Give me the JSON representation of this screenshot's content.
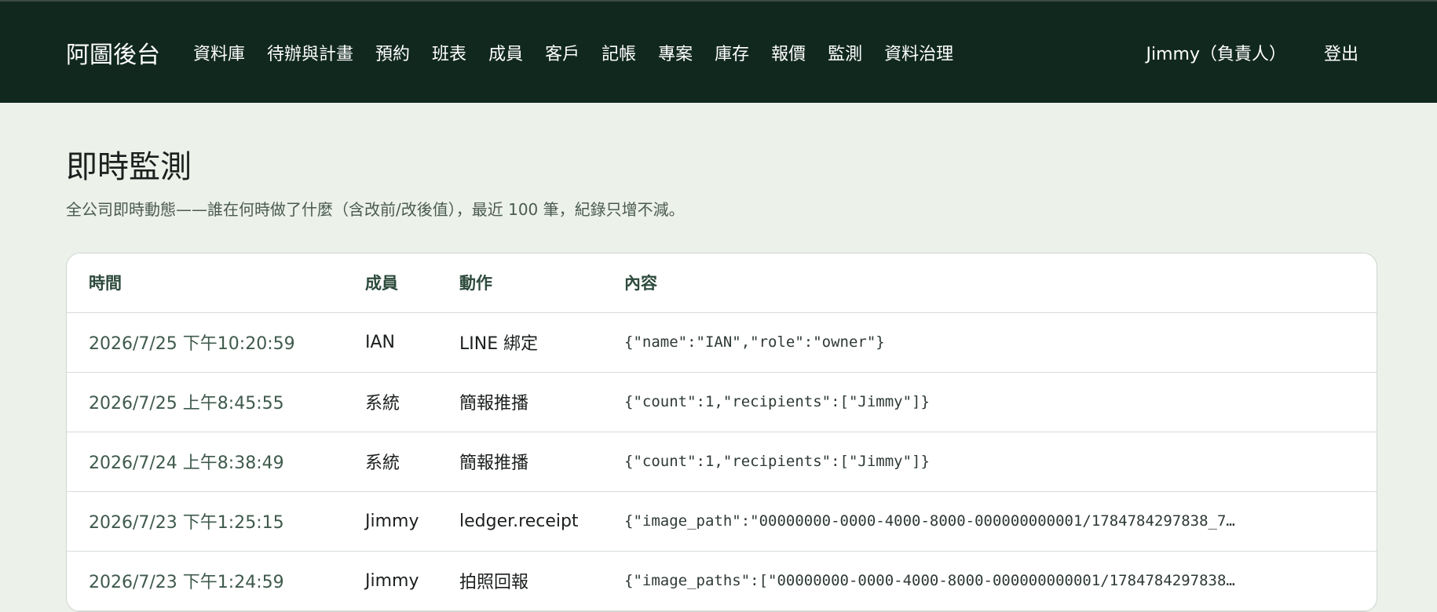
{
  "header": {
    "brand": "阿圖後台",
    "nav": [
      "資料庫",
      "待辦與計畫",
      "預約",
      "班表",
      "成員",
      "客戶",
      "記帳",
      "專案",
      "庫存",
      "報價",
      "監測",
      "資料治理"
    ],
    "user": "Jimmy（負責人）",
    "logout": "登出"
  },
  "page": {
    "title": "即時監測",
    "subtitle": "全公司即時動態——誰在何時做了什麼（含改前/改後值），最近 100 筆，紀錄只增不減。"
  },
  "table": {
    "columns": [
      "時間",
      "成員",
      "動作",
      "內容"
    ],
    "rows": [
      {
        "time": "2026/7/25 下午10:20:59",
        "member": "IAN",
        "action": "LINE 綁定",
        "content": "{\"name\":\"IAN\",\"role\":\"owner\"}"
      },
      {
        "time": "2026/7/25 上午8:45:55",
        "member": "系統",
        "action": "簡報推播",
        "content": "{\"count\":1,\"recipients\":[\"Jimmy\"]}"
      },
      {
        "time": "2026/7/24 上午8:38:49",
        "member": "系統",
        "action": "簡報推播",
        "content": "{\"count\":1,\"recipients\":[\"Jimmy\"]}"
      },
      {
        "time": "2026/7/23 下午1:25:15",
        "member": "Jimmy",
        "action": "ledger.receipt",
        "content": "{\"image_path\":\"00000000-0000-4000-8000-000000000001/1784784297838_7…"
      },
      {
        "time": "2026/7/23 下午1:24:59",
        "member": "Jimmy",
        "action": "拍照回報",
        "content": "{\"image_paths\":[\"00000000-0000-4000-8000-000000000001/1784784297838…"
      }
    ]
  }
}
